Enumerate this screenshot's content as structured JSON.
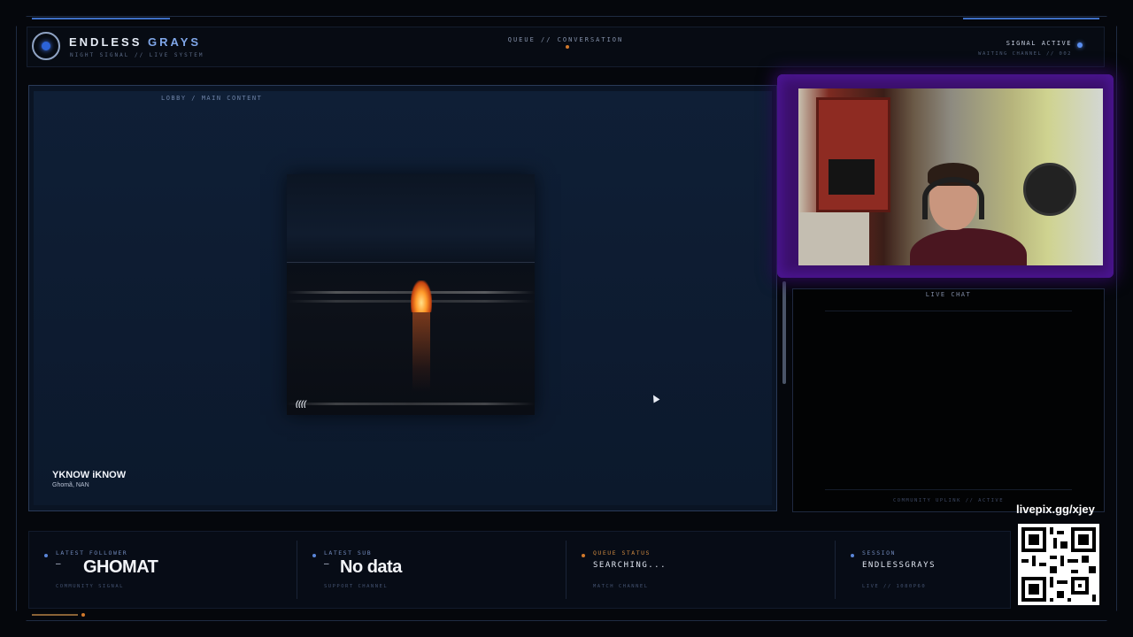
{
  "header": {
    "brand_left": "ENDLESS",
    "brand_right": "GRAYS",
    "brand_subtitle": "NIGHT SIGNAL // LIVE SYSTEM",
    "center_title": "QUEUE // CONVERSATION",
    "signal_status": "SIGNAL ACTIVE",
    "waiting_channel": "WAITING CHANNEL // 002",
    "logo_icon": "ring-eye-icon"
  },
  "main": {
    "label": "LOBBY / MAIN CONTENT",
    "song_title": "YKNOW iKNOW",
    "song_artist": "Ghomã, NAN",
    "album_logo_text": "(((("
  },
  "chat": {
    "title": "LIVE CHAT",
    "footer": "COMMUNITY UPLINK // ACTIVE"
  },
  "stats": [
    {
      "label": "LATEST FOLLOWER",
      "dash": "–",
      "value": "GHOMAT",
      "sub": "COMMUNITY SIGNAL",
      "accent": "#5a86d8"
    },
    {
      "label": "LATEST SUB",
      "dash": "–",
      "value": "No data",
      "sub": "SUPPORT CHANNEL",
      "accent": "#5a86d8"
    },
    {
      "label": "QUEUE STATUS",
      "value": "SEARCHING...",
      "sub": "MATCH CHANNEL",
      "accent": "#d2792b"
    },
    {
      "label": "SESSION",
      "value": "ENDLESSGRAYS",
      "sub": "LIVE // 1080P60",
      "accent": "#5a86d8"
    }
  ],
  "qr": {
    "label": "livepix.gg/xjey"
  },
  "colors": {
    "accent_blue": "#5a86d8",
    "accent_orange": "#d2792b",
    "webcam_glow": "#4a1590"
  }
}
